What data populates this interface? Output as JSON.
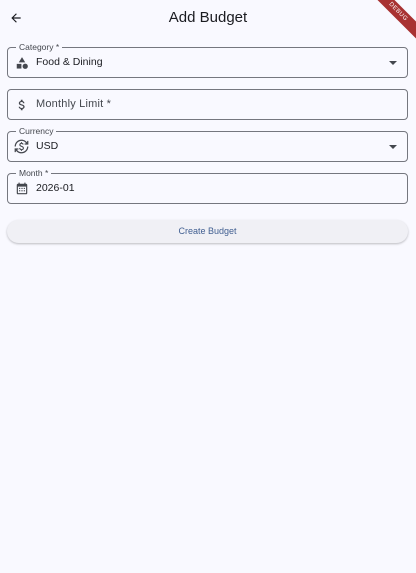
{
  "appbar": {
    "title": "Add Budget",
    "back_icon": "arrow-back-icon",
    "debug_banner": "DEBUG"
  },
  "form": {
    "category": {
      "label": "Category *",
      "value": "Food & Dining",
      "icon": "category-shapes-icon"
    },
    "monthly_limit": {
      "placeholder": "Monthly Limit *",
      "value": "",
      "icon": "dollar-icon"
    },
    "currency": {
      "label": "Currency",
      "value": "USD",
      "icon": "currency-exchange-icon"
    },
    "month": {
      "label": "Month *",
      "value": "2026-01",
      "icon": "calendar-icon"
    }
  },
  "actions": {
    "create_label": "Create Budget"
  },
  "colors": {
    "background": "#f9f9ff",
    "outline": "#75777f",
    "primary": "#415f91",
    "debug": "#a83232"
  }
}
